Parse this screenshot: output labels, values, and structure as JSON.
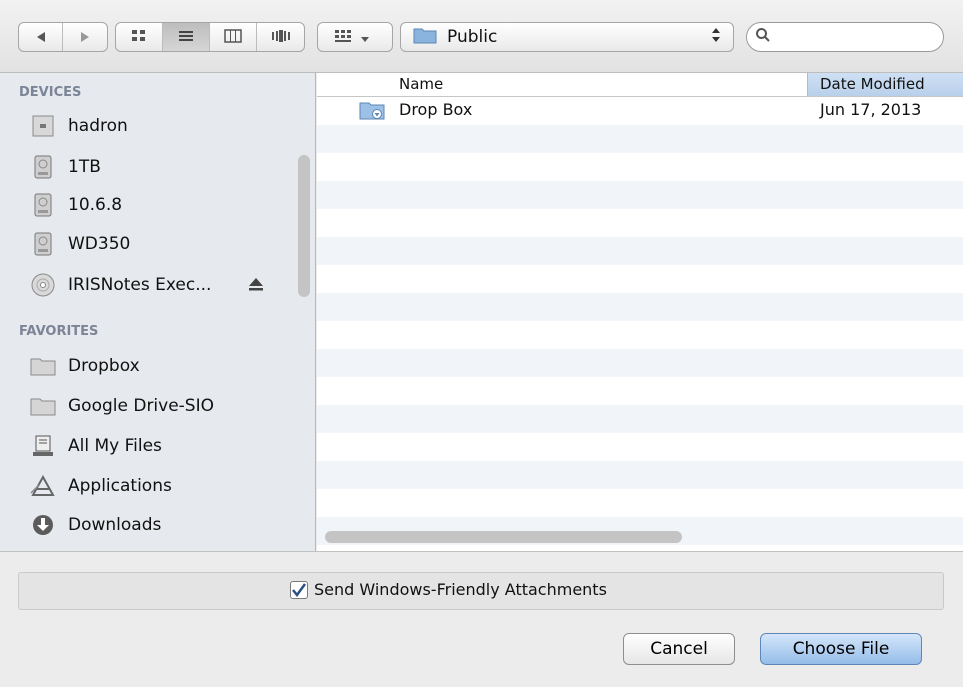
{
  "toolbar": {
    "nav": [
      "back-icon",
      "forward-icon"
    ],
    "views": [
      "icon-view-icon",
      "list-view-icon",
      "column-view-icon",
      "coverflow-view-icon"
    ],
    "arrange_icon": "arrange-icon",
    "location": "Public",
    "search_placeholder": ""
  },
  "sidebar": {
    "devices_header": "DEVICES",
    "devices": [
      {
        "label": "hadron",
        "icon": "computer-icon"
      },
      {
        "label": "1TB",
        "icon": "hard-disk-icon"
      },
      {
        "label": "10.6.8",
        "icon": "hard-disk-icon"
      },
      {
        "label": "WD350",
        "icon": "hard-disk-icon"
      },
      {
        "label": "IRISNotes Exec...",
        "icon": "disc-icon"
      }
    ],
    "favorites_header": "FAVORITES",
    "favorites": [
      {
        "label": "Dropbox",
        "icon": "folder-icon"
      },
      {
        "label": "Google Drive-SIO",
        "icon": "folder-icon"
      },
      {
        "label": "All My Files",
        "icon": "all-files-icon"
      },
      {
        "label": "Applications",
        "icon": "applications-icon"
      },
      {
        "label": "Downloads",
        "icon": "downloads-icon"
      }
    ]
  },
  "filelist": {
    "columns": {
      "name": "Name",
      "date": "Date Modified"
    },
    "files": [
      {
        "name": "Drop Box",
        "date": "Jun 17, 2013"
      }
    ]
  },
  "bottom": {
    "checkbox_label": "Send Windows-Friendly Attachments",
    "cancel_label": "Cancel",
    "choose_label": "Choose File"
  },
  "colors": {
    "accent": "#94bde9",
    "sidebar_bg": "#e6e9ee",
    "header_text": "#7b8597"
  }
}
